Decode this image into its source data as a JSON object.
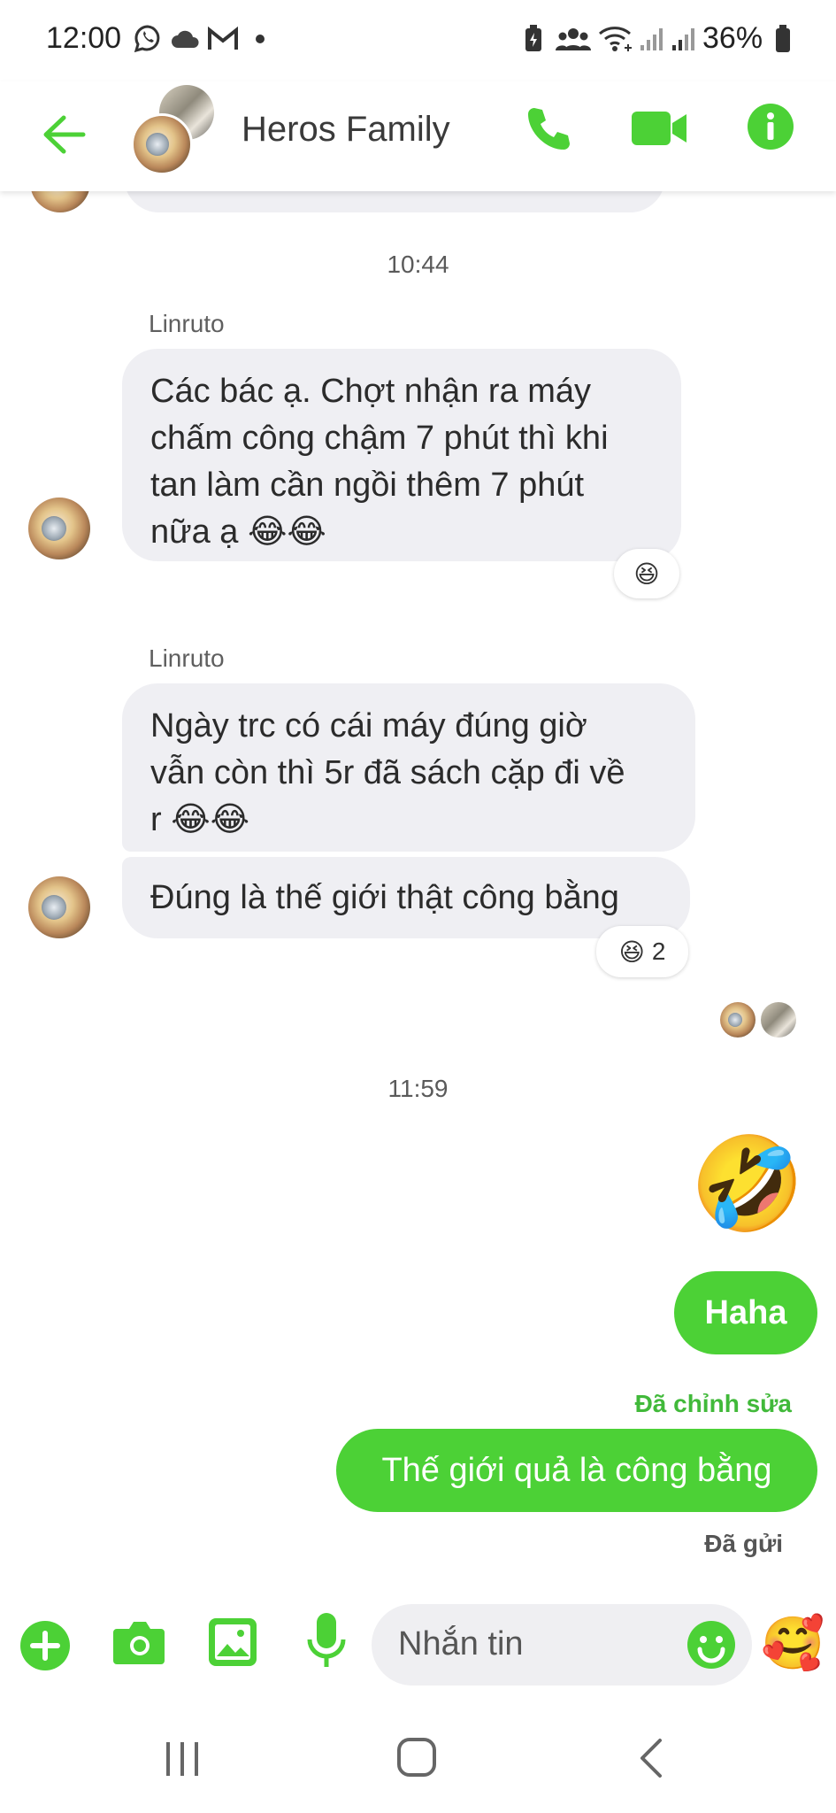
{
  "status_bar": {
    "time": "12:00",
    "battery_percent": "36%",
    "icons": [
      "viber-icon",
      "cloud-icon",
      "gmail-icon",
      "dot-icon",
      "battery-saver-icon",
      "people-icon",
      "wifi-icon",
      "signal-icon",
      "signal-icon",
      "battery-icon"
    ]
  },
  "header": {
    "title": "Heros Family",
    "icons": [
      "back-arrow-icon",
      "phone-icon",
      "video-icon",
      "info-icon"
    ]
  },
  "colors": {
    "accent": "#4cd136",
    "incoming_bubble": "#efeff3",
    "meta_green": "#41b93a"
  },
  "messages": {
    "ts1": "10:44",
    "ts2": "11:59",
    "group1_sender": "Linruto",
    "msg1": "Các bác ạ. Chợt nhận ra máy chấm công chậm 7 phút thì khi tan làm cần ngồi thêm 7 phút nữa ạ 😂😂",
    "msg1_lines": [
      "Các bác ạ. Chợt nhận ra máy",
      "chấm công chậm 7 phút thì khi",
      "tan làm cần ngồi thêm 7 phút",
      "nữa ạ 😂😂"
    ],
    "msg1_reaction": "😆",
    "group2_sender": "Linruto",
    "msg2_lines": [
      "Ngày trc có cái máy đúng giờ",
      "vẫn còn thì 5r đã sách cặp đi về",
      "r 😂😂"
    ],
    "msg3": "Đúng là thế giới thật công bằng",
    "msg3_reaction_emoji": "😆",
    "msg3_reaction_count": "2",
    "big_emoji": "🤣",
    "out1": "Haha",
    "edited_label": "Đã chỉnh sửa",
    "out2": "Thế giới quả là công bằng",
    "sent_label": "Đã gửi"
  },
  "composer": {
    "placeholder": "Nhắn tin",
    "sticker_emoji": "🥰",
    "icons": [
      "plus-icon",
      "camera-icon",
      "image-icon",
      "mic-icon",
      "smiley-icon"
    ]
  },
  "nav": {
    "icons": [
      "recent-apps-icon",
      "home-icon",
      "back-icon"
    ]
  }
}
